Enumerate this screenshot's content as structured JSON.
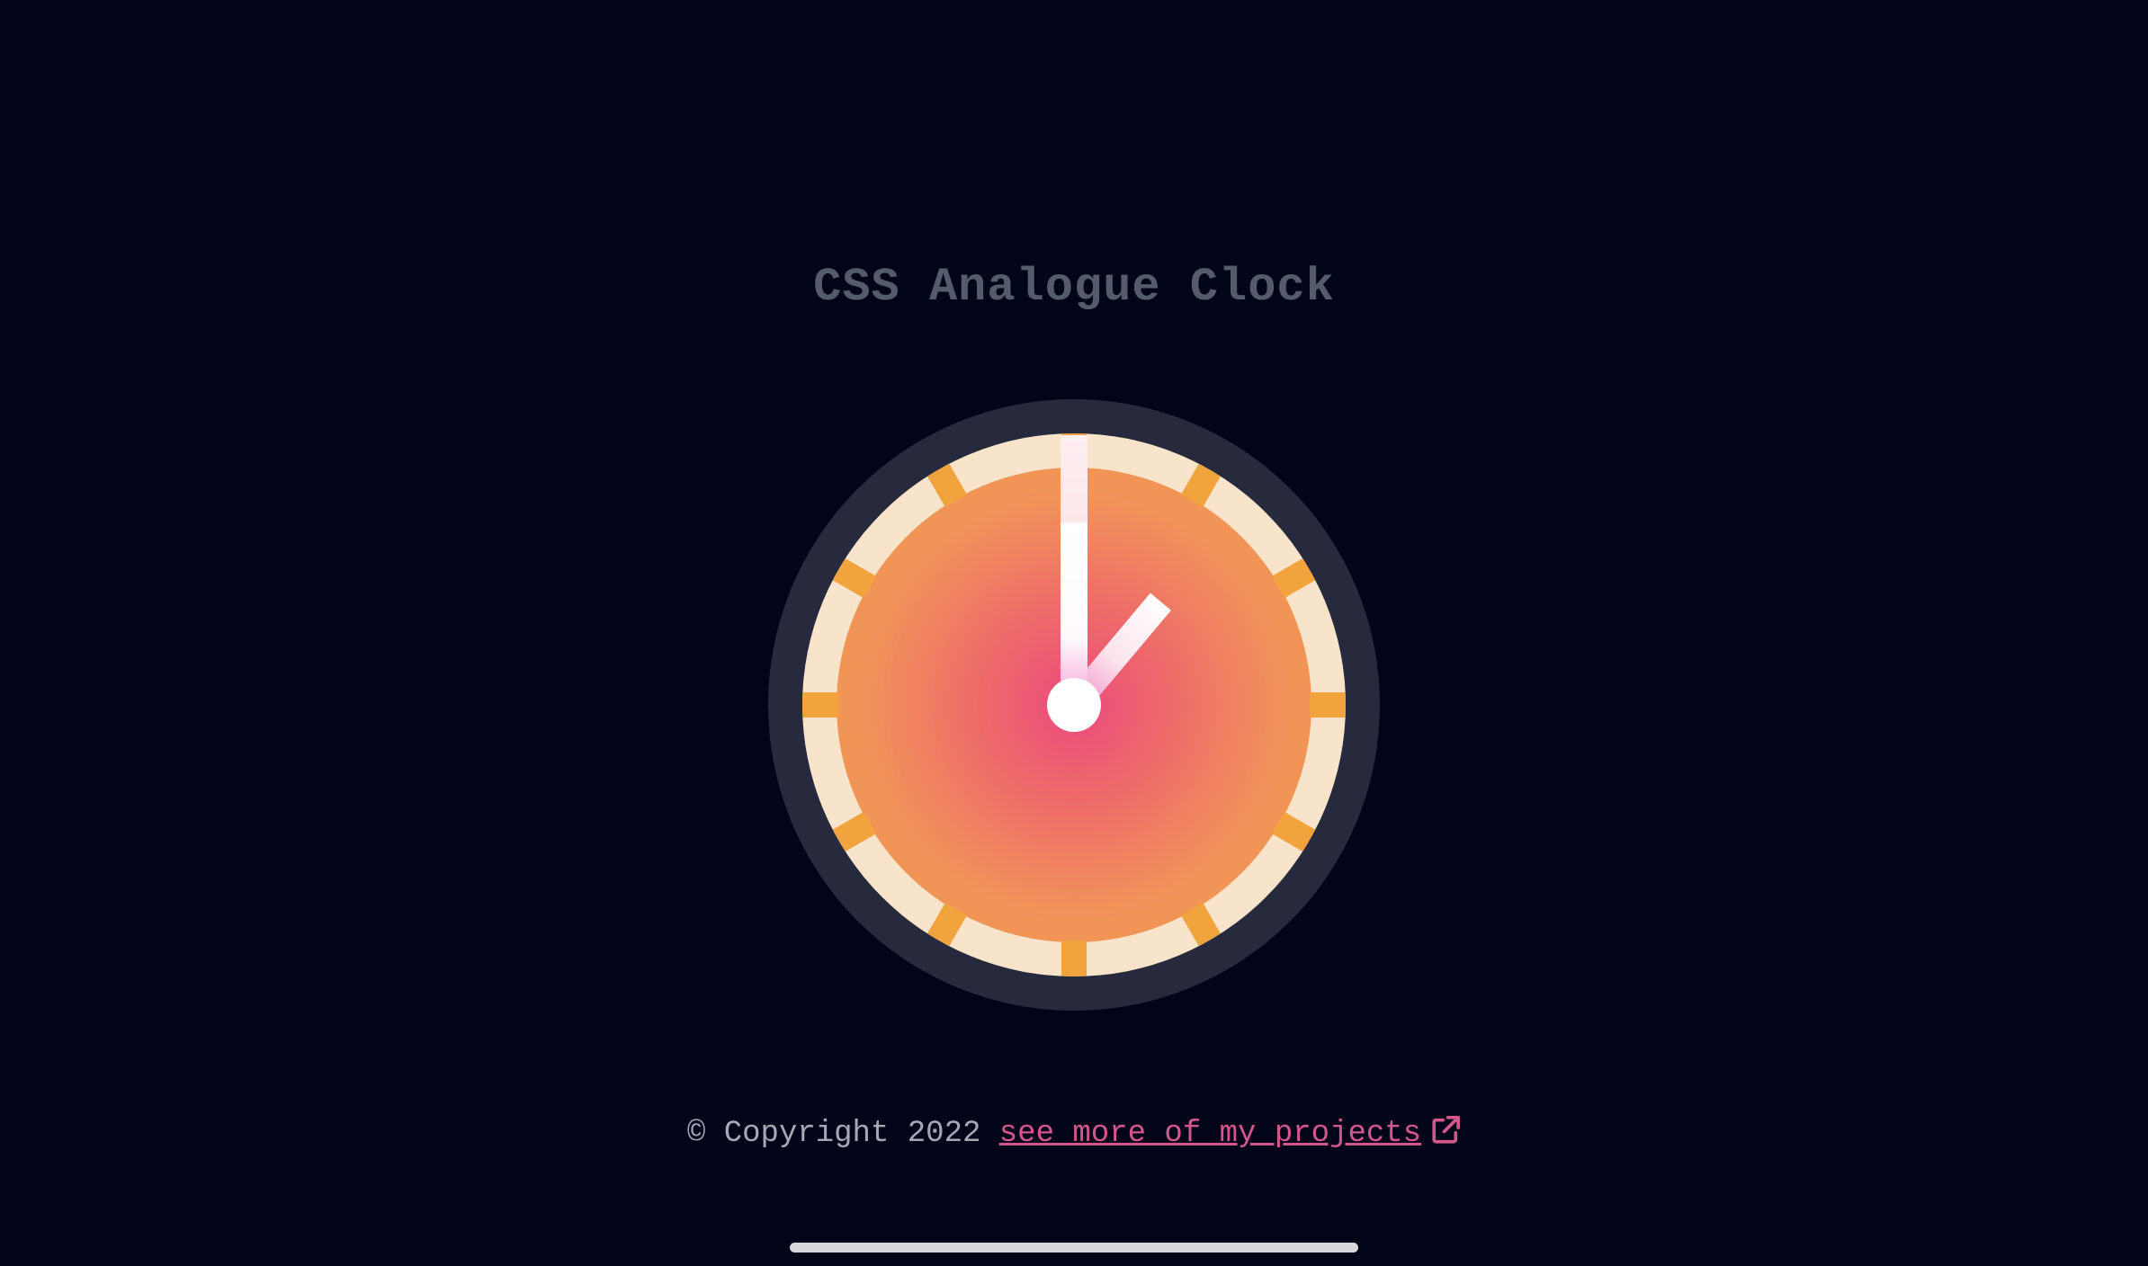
{
  "page": {
    "title": "CSS Analogue Clock",
    "background_color": "#02041a"
  },
  "clock": {
    "time_shown": "1:00",
    "hour_hand_angle_deg": 40,
    "minute_hand_angle_deg": 0,
    "hour_markers": 12,
    "bezel_color": "#272a3d",
    "face_ring_color": "#f8e4ca",
    "marker_color": "#f1a43d",
    "face_gradient": [
      "#ea4a7e",
      "#f19b47"
    ],
    "hand_color": "#ffffff"
  },
  "footer": {
    "copyright": "© Copyright 2022",
    "link_text": "see more of my projects",
    "link_icon": "external-link-icon",
    "link_color": "#d4578c"
  }
}
